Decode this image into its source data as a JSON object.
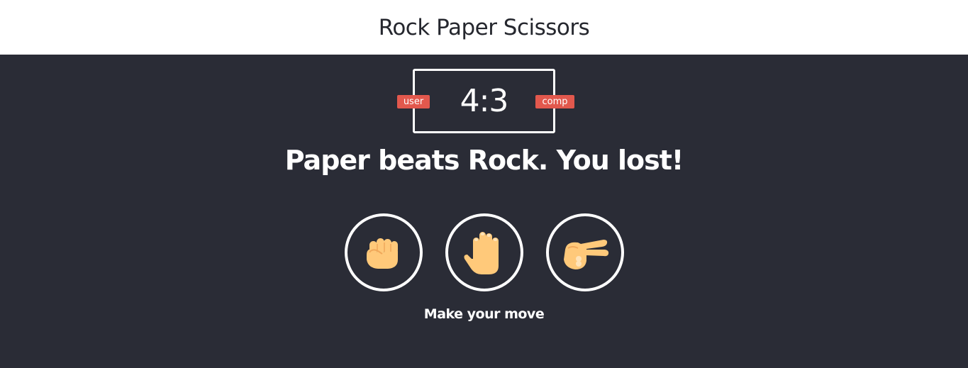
{
  "header": {
    "title": "Rock Paper Scissors"
  },
  "scoreboard": {
    "user_label": "user",
    "comp_label": "comp",
    "score": "4:3",
    "badge_color": "#e2584d"
  },
  "result": {
    "message": "Paper beats Rock. You lost!"
  },
  "choices": [
    {
      "name": "rock",
      "icon": "fist-icon"
    },
    {
      "name": "paper",
      "icon": "raised-hand-icon"
    },
    {
      "name": "scissors",
      "icon": "victory-hand-icon"
    }
  ],
  "prompt": {
    "text": "Make your move"
  },
  "colors": {
    "background": "#2a2c36",
    "header_background": "#ffffff",
    "skin": "#ffc97a"
  }
}
